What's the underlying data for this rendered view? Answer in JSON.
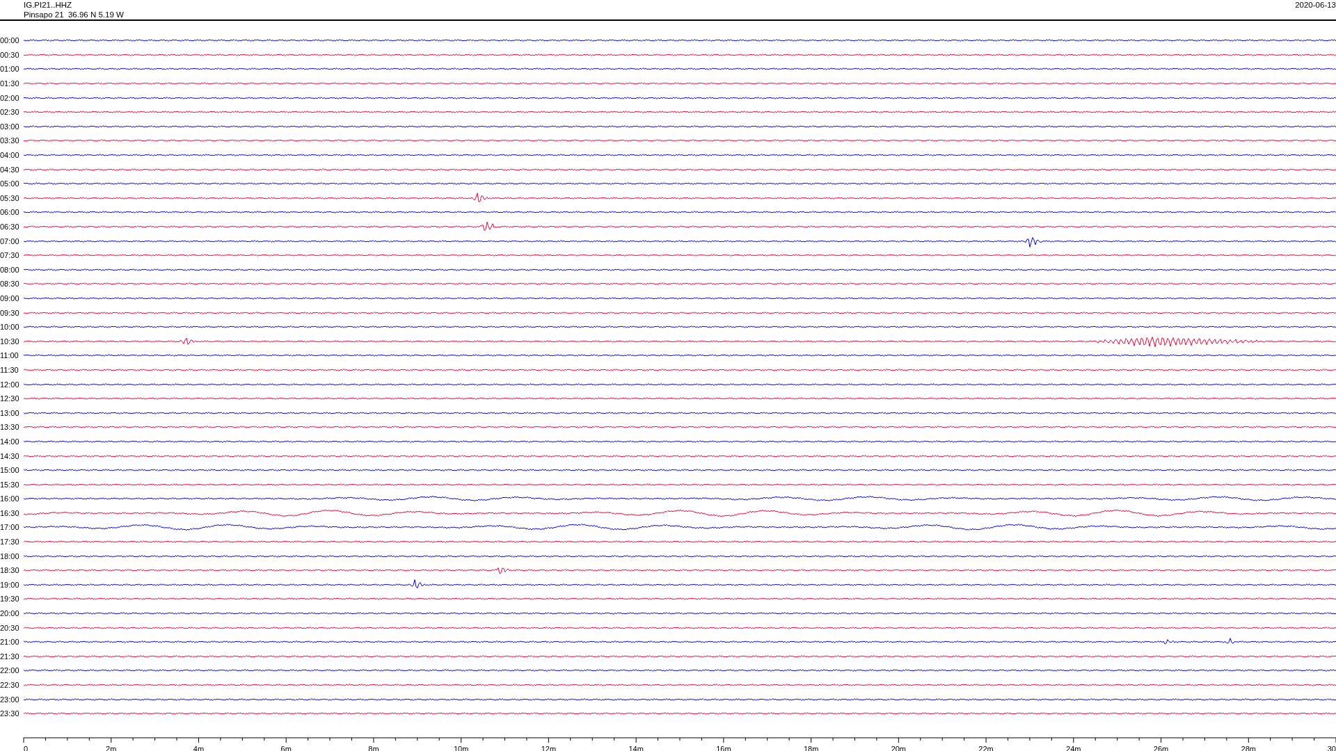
{
  "header": {
    "station": "IG.PI21..HHZ",
    "location": "Pinsapo 21  36.96 N 5.19 W",
    "date": "2020-06-13"
  },
  "rows": [
    {
      "time": "00:00",
      "color": "#0000ff"
    },
    {
      "time": "00:30",
      "color": "#ff0033"
    },
    {
      "time": "01:00",
      "color": "#0000ff"
    },
    {
      "time": "01:30",
      "color": "#ff0033"
    },
    {
      "time": "02:00",
      "color": "#0000ff"
    },
    {
      "time": "02:30",
      "color": "#ff0033"
    },
    {
      "time": "03:00",
      "color": "#0000ff"
    },
    {
      "time": "03:30",
      "color": "#ff0033"
    },
    {
      "time": "04:00",
      "color": "#0000ff"
    },
    {
      "time": "04:30",
      "color": "#ff0033"
    },
    {
      "time": "05:00",
      "color": "#0000ff"
    },
    {
      "time": "05:30",
      "color": "#ff0033"
    },
    {
      "time": "06:00",
      "color": "#0000ff"
    },
    {
      "time": "06:30",
      "color": "#ff0033"
    },
    {
      "time": "07:00",
      "color": "#0000ff"
    },
    {
      "time": "07:30",
      "color": "#ff0033"
    },
    {
      "time": "08:00",
      "color": "#0000ff"
    },
    {
      "time": "08:30",
      "color": "#ff0033"
    },
    {
      "time": "09:00",
      "color": "#0000ff"
    },
    {
      "time": "09:30",
      "color": "#ff0033"
    },
    {
      "time": "10:00",
      "color": "#0000ff"
    },
    {
      "time": "10:30",
      "color": "#ff0033"
    },
    {
      "time": "11:00",
      "color": "#0000ff"
    },
    {
      "time": "11:30",
      "color": "#ff0033"
    },
    {
      "time": "12:00",
      "color": "#0000ff"
    },
    {
      "time": "12:30",
      "color": "#ff0033"
    },
    {
      "time": "13:00",
      "color": "#0000ff"
    },
    {
      "time": "13:30",
      "color": "#ff0033"
    },
    {
      "time": "14:00",
      "color": "#0000ff"
    },
    {
      "time": "14:30",
      "color": "#ff0033"
    },
    {
      "time": "15:00",
      "color": "#0000ff"
    },
    {
      "time": "15:30",
      "color": "#ff0033"
    },
    {
      "time": "16:00",
      "color": "#0000ff"
    },
    {
      "time": "16:30",
      "color": "#ff0033"
    },
    {
      "time": "17:00",
      "color": "#0000ff"
    },
    {
      "time": "17:30",
      "color": "#ff0033"
    },
    {
      "time": "18:00",
      "color": "#0000ff"
    },
    {
      "time": "18:30",
      "color": "#ff0033"
    },
    {
      "time": "19:00",
      "color": "#0000ff"
    },
    {
      "time": "19:30",
      "color": "#ff0033"
    },
    {
      "time": "20:00",
      "color": "#0000ff"
    },
    {
      "time": "20:30",
      "color": "#ff0033"
    },
    {
      "time": "21:00",
      "color": "#0000ff"
    },
    {
      "time": "21:30",
      "color": "#ff0033"
    },
    {
      "time": "22:00",
      "color": "#0000ff"
    },
    {
      "time": "22:30",
      "color": "#ff0033"
    },
    {
      "time": "23:00",
      "color": "#0000ff"
    },
    {
      "time": "23:30",
      "color": "#ff0033"
    }
  ],
  "time_axis": {
    "labels": [
      "0",
      "2m",
      "4m",
      "6m",
      "8m",
      "10m",
      "12m",
      "14m",
      "16m",
      "18m",
      "20m",
      "22m",
      "24m",
      "26m",
      "28m",
      "30"
    ]
  }
}
